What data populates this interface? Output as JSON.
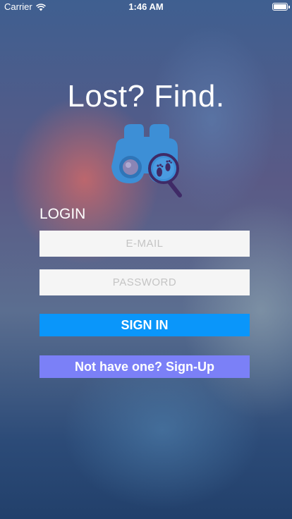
{
  "status_bar": {
    "carrier": "Carrier",
    "time": "1:46 AM"
  },
  "app": {
    "title": "Lost? Find."
  },
  "login": {
    "label": "LOGIN",
    "email_placeholder": "E-MAIL",
    "email_value": "",
    "password_placeholder": "PASSWORD",
    "password_value": "",
    "signin_label": "SIGN IN",
    "signup_label": "Not have one? Sign-Up"
  },
  "colors": {
    "signin_button": "#0a96fa",
    "signup_button": "#7b80f7",
    "logo_blue": "#3d8fd6",
    "logo_accent": "#3f2a66"
  },
  "icons": {
    "logo": "binoculars-magnifier-footprint-icon",
    "wifi": "wifi-icon",
    "battery": "battery-icon"
  }
}
